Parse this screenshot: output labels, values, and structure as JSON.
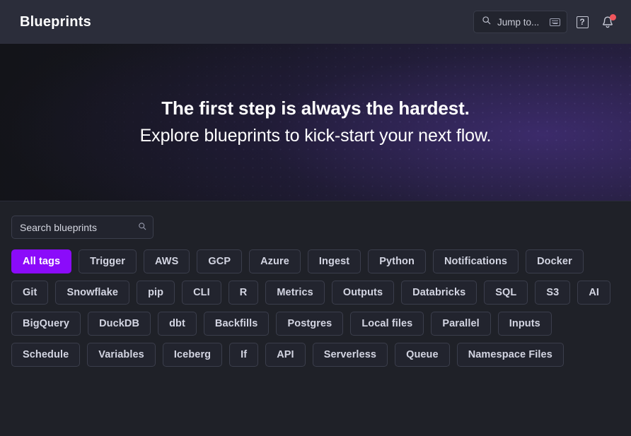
{
  "header": {
    "title": "Blueprints",
    "search": {
      "placeholder": "Jump to...",
      "icon": "search-icon",
      "shortcut_icon": "keyboard-icon"
    },
    "help_label": "?",
    "help_icon": "help-icon",
    "notifications_icon": "bell-icon",
    "notifications_badge": true
  },
  "hero": {
    "headline": "The first step is always the hardest.",
    "subheadline": "Explore blueprints to kick-start your next flow."
  },
  "search": {
    "value": "Search blueprints",
    "placeholder": "Search blueprints",
    "icon": "search-icon"
  },
  "tags": [
    {
      "label": "All tags",
      "active": true
    },
    {
      "label": "Trigger",
      "active": false
    },
    {
      "label": "AWS",
      "active": false
    },
    {
      "label": "GCP",
      "active": false
    },
    {
      "label": "Azure",
      "active": false
    },
    {
      "label": "Ingest",
      "active": false
    },
    {
      "label": "Python",
      "active": false
    },
    {
      "label": "Notifications",
      "active": false
    },
    {
      "label": "Docker",
      "active": false
    },
    {
      "label": "Git",
      "active": false
    },
    {
      "label": "Snowflake",
      "active": false
    },
    {
      "label": "pip",
      "active": false
    },
    {
      "label": "CLI",
      "active": false
    },
    {
      "label": "R",
      "active": false
    },
    {
      "label": "Metrics",
      "active": false
    },
    {
      "label": "Outputs",
      "active": false
    },
    {
      "label": "Databricks",
      "active": false
    },
    {
      "label": "SQL",
      "active": false
    },
    {
      "label": "S3",
      "active": false
    },
    {
      "label": "AI",
      "active": false
    },
    {
      "label": "BigQuery",
      "active": false
    },
    {
      "label": "DuckDB",
      "active": false
    },
    {
      "label": "dbt",
      "active": false
    },
    {
      "label": "Backfills",
      "active": false
    },
    {
      "label": "Postgres",
      "active": false
    },
    {
      "label": "Local files",
      "active": false
    },
    {
      "label": "Parallel",
      "active": false
    },
    {
      "label": "Inputs",
      "active": false
    },
    {
      "label": "Schedule",
      "active": false
    },
    {
      "label": "Variables",
      "active": false
    },
    {
      "label": "Iceberg",
      "active": false
    },
    {
      "label": "If",
      "active": false
    },
    {
      "label": "API",
      "active": false
    },
    {
      "label": "Serverless",
      "active": false
    },
    {
      "label": "Queue",
      "active": false
    },
    {
      "label": "Namespace Files",
      "active": false
    }
  ],
  "colors": {
    "accent": "#8b0bfa",
    "topbar_bg": "#2b2d3a",
    "page_bg": "#1f2128",
    "badge": "#f0555c"
  }
}
